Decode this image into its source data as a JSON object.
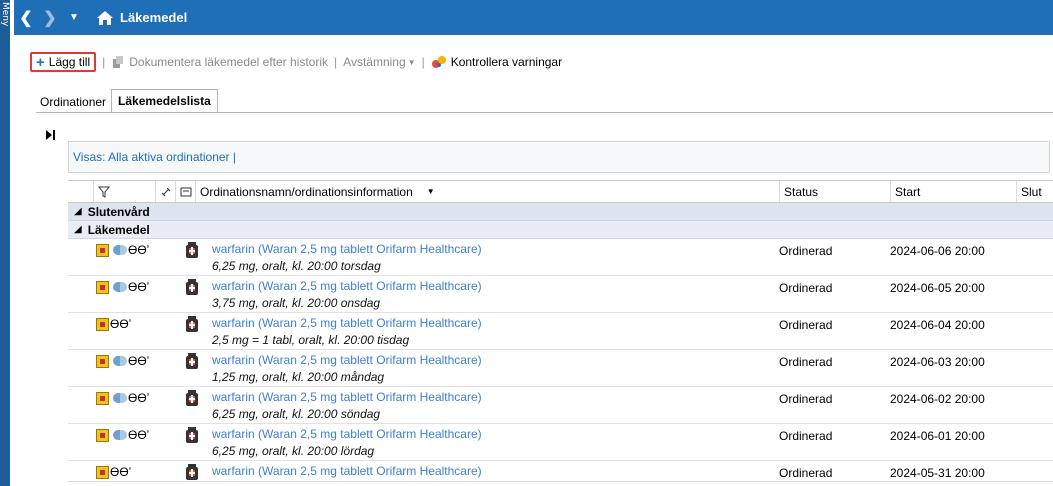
{
  "sidebar": {
    "label": "Meny"
  },
  "titlebar": {
    "title": "Läkemedel"
  },
  "toolbar": {
    "add_label": "Lägg till",
    "document_label": "Dokumentera läkemedel efter historik",
    "reconcile_label": "Avstämning",
    "check_warnings_label": "Kontrollera varningar",
    "separator": "|"
  },
  "tabs": [
    {
      "label": "Ordinationer",
      "active": false
    },
    {
      "label": "Läkemedelslista",
      "active": true
    }
  ],
  "filter": {
    "text": "Visas: Alla aktiva ordinationer  |"
  },
  "grid": {
    "columns": {
      "name": "Ordinationsnamn/ordinationsinformation",
      "status": "Status",
      "start": "Start",
      "end": "Slut"
    },
    "groups": {
      "care": "Slutenvård",
      "medication": "Läkemedel"
    },
    "rows": [
      {
        "name": "warfarin (Waran 2,5 mg tablett Orifarm Healthcare)",
        "dose": "6,25 mg, oralt, kl. 20:00 torsdag",
        "status": "Ordinerad",
        "start": "2024-06-06 20:00",
        "pill": true
      },
      {
        "name": "warfarin (Waran 2,5 mg tablett Orifarm Healthcare)",
        "dose": "3,75 mg, oralt, kl. 20:00 onsdag",
        "status": "Ordinerad",
        "start": "2024-06-05 20:00",
        "pill": true
      },
      {
        "name": "warfarin (Waran 2,5 mg tablett Orifarm Healthcare)",
        "dose": "2,5 mg = 1 tabl, oralt, kl. 20:00 tisdag",
        "status": "Ordinerad",
        "start": "2024-06-04 20:00",
        "pill": false
      },
      {
        "name": "warfarin (Waran 2,5 mg tablett Orifarm Healthcare)",
        "dose": "1,25 mg, oralt, kl. 20:00 måndag",
        "status": "Ordinerad",
        "start": "2024-06-03 20:00",
        "pill": true
      },
      {
        "name": "warfarin (Waran 2,5 mg tablett Orifarm Healthcare)",
        "dose": "6,25 mg, oralt, kl. 20:00 söndag",
        "status": "Ordinerad",
        "start": "2024-06-02 20:00",
        "pill": true
      },
      {
        "name": "warfarin (Waran 2,5 mg tablett Orifarm Healthcare)",
        "dose": "6,25 mg, oralt, kl. 20:00 lördag",
        "status": "Ordinerad",
        "start": "2024-06-01 20:00",
        "pill": true
      },
      {
        "name": "warfarin (Waran 2,5 mg tablett Orifarm Healthcare)",
        "dose": "",
        "status": "Ordinerad",
        "start": "2024-05-31 20:00",
        "pill": false
      }
    ]
  },
  "colors": {
    "titlebar": "#1f6fb6",
    "sidebar": "#1f5d99",
    "link": "#3d7fcf",
    "highlight_border": "#e0393b",
    "group_bg": "#dce4f0"
  },
  "icons": [
    "back-icon",
    "forward-icon",
    "dropdown-icon",
    "home-icon",
    "plus-icon",
    "document-icon",
    "warnings-icon",
    "filter-icon",
    "link-icon",
    "note-icon",
    "alert-icon",
    "pill-icon",
    "glasses-icon",
    "medicine-bottle-icon"
  ]
}
